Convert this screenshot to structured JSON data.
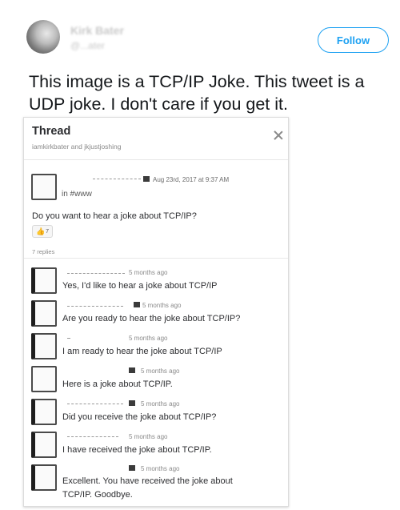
{
  "tweet": {
    "author_name": "Kirk Bater",
    "author_handle": "@...ater",
    "follow_label": "Follow",
    "text_line1": "This image is a TCP/IP Joke.  This tweet is a",
    "text_line2": "UDP joke.  I don't care if you get it."
  },
  "thread": {
    "title": "Thread",
    "subtitle": "iamkirkbater and jkjustjoshing",
    "parent": {
      "timestamp": "Aug 23rd, 2017 at 9:37 AM",
      "channel": "in #www",
      "message": "Do you want to hear a joke about TCP/IP?",
      "reaction_count": "7"
    },
    "replies_label": "7 replies",
    "replies": [
      {
        "timestamp": "5 months ago",
        "message": "Yes, I'd like to hear a joke about TCP/IP"
      },
      {
        "timestamp": "5 months ago",
        "message": "Are you ready to hear the joke about TCP/IP?"
      },
      {
        "timestamp": "5 months ago",
        "message": "I am ready to hear the joke about TCP/IP"
      },
      {
        "timestamp": "5 months ago",
        "message": "Here is a joke about TCP/IP."
      },
      {
        "timestamp": "5 months ago",
        "message": "Did you receive the joke about TCP/IP?"
      },
      {
        "timestamp": "5 months ago",
        "message": "I have received the joke about TCP/IP."
      },
      {
        "timestamp": "5 months ago",
        "message_line1": "Excellent.  You have received the joke about",
        "message_line2": "TCP/IP.  Goodbye."
      }
    ]
  },
  "icons": {
    "close": "close-icon",
    "reaction": "thumbs-up-icon"
  },
  "colors": {
    "follow_blue": "#1da1f2",
    "text": "#14171a"
  }
}
